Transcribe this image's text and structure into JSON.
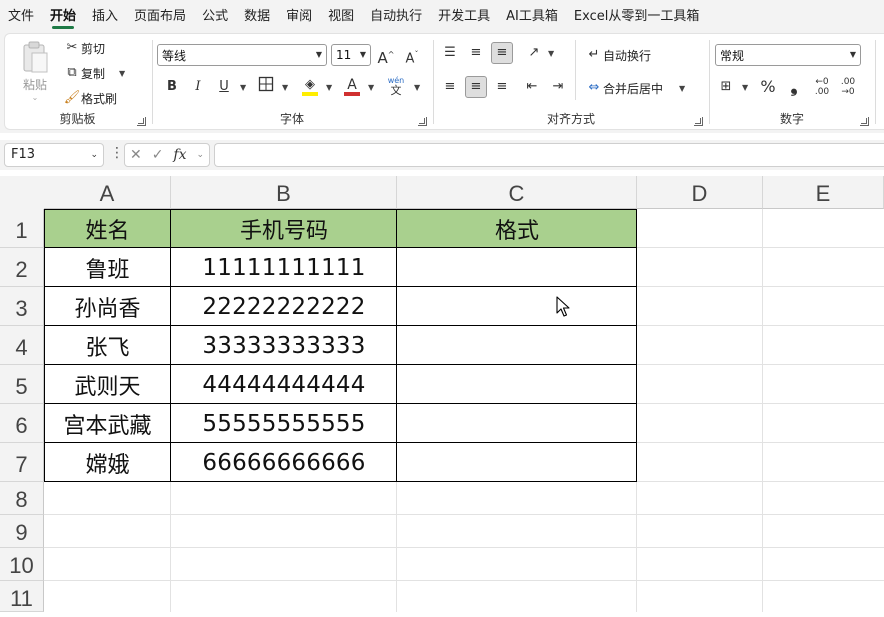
{
  "menu": {
    "tabs": [
      "文件",
      "开始",
      "插入",
      "页面布局",
      "公式",
      "数据",
      "审阅",
      "视图",
      "自动执行",
      "开发工具",
      "AI工具箱",
      "Excel从零到一工具箱"
    ],
    "active": "开始"
  },
  "ribbon": {
    "clipboard": {
      "paste": "粘贴",
      "cut": "剪切",
      "copy": "复制",
      "format_painter": "格式刷",
      "label": "剪贴板"
    },
    "font": {
      "name": "等线",
      "size": "11",
      "grow": "A",
      "shrink": "A",
      "bold": "B",
      "italic": "I",
      "underline": "U",
      "label": "字体",
      "phonetic": "wén"
    },
    "alignment": {
      "wrap": "自动换行",
      "merge": "合并后居中",
      "label": "对齐方式"
    },
    "number": {
      "format": "常规",
      "label": "数字",
      "percent": "%",
      "comma": "❟"
    }
  },
  "formula_bar": {
    "name_box": "F13",
    "fx": "fx",
    "formula": ""
  },
  "sheet": {
    "columns": [
      "A",
      "B",
      "C",
      "D",
      "E"
    ],
    "rows": [
      "1",
      "2",
      "3",
      "4",
      "5",
      "6",
      "7",
      "8",
      "9",
      "10",
      "11"
    ],
    "header": [
      "姓名",
      "手机号码",
      "格式"
    ],
    "data": [
      {
        "name": "鲁班",
        "phone": "11111111111",
        "format": ""
      },
      {
        "name": "孙尚香",
        "phone": "22222222222",
        "format": ""
      },
      {
        "name": "张飞",
        "phone": "33333333333",
        "format": ""
      },
      {
        "name": "武则天",
        "phone": "44444444444",
        "format": ""
      },
      {
        "name": "宫本武藏",
        "phone": "55555555555",
        "format": ""
      },
      {
        "name": "嫦娥",
        "phone": "66666666666",
        "format": ""
      }
    ]
  },
  "colors": {
    "header_fill": "#a9d08e",
    "accent": "#1e7a46",
    "font_color": "#d03030",
    "highlight": "#ffee00"
  }
}
